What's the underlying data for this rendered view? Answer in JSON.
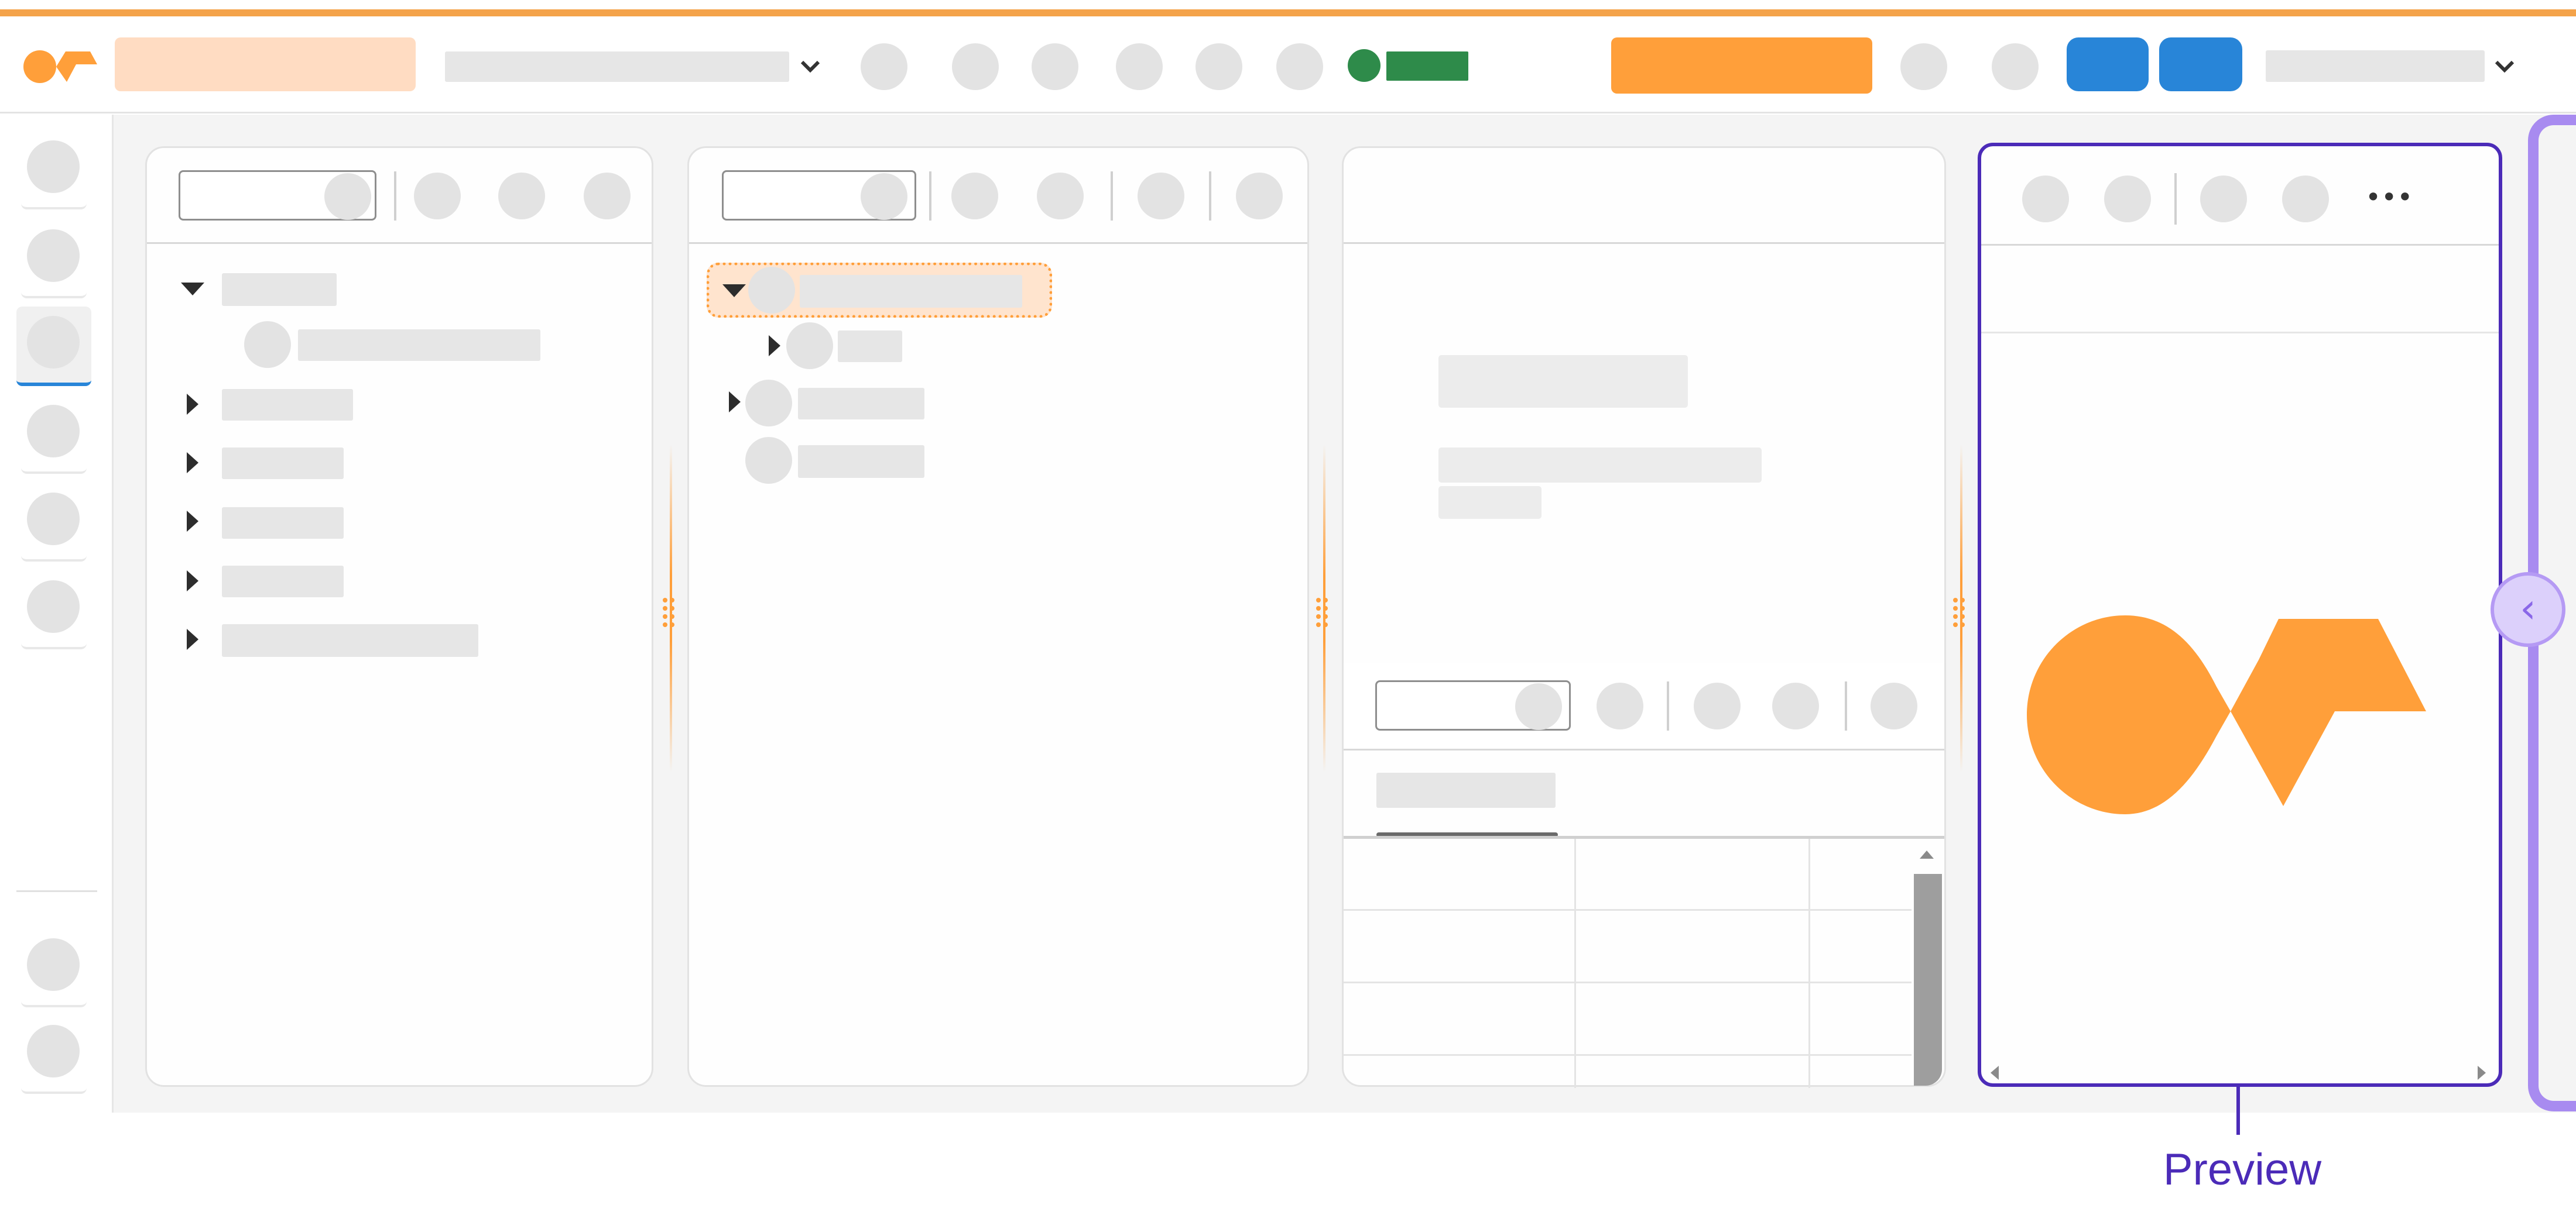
{
  "colors": {
    "accent_orange": "#ff9f3a",
    "light_orange": "#ffdcc2",
    "status_green": "#2e8b4a",
    "blue_button": "#2885d8",
    "highlight_purple": "#4b2bb8",
    "panel_purple": "#a88bf0"
  },
  "icons": {
    "logo": "app-logo",
    "chevron": "chevron-down-icon",
    "collapse": "chevron-left-icon",
    "more": "more-horizontal-icon",
    "expand": "triangle-right-icon",
    "collapse_tree": "triangle-down-icon"
  },
  "preview_panel": {
    "more_label": "•••",
    "collapse_glyph": "‹"
  },
  "callout": {
    "label": "Preview"
  }
}
